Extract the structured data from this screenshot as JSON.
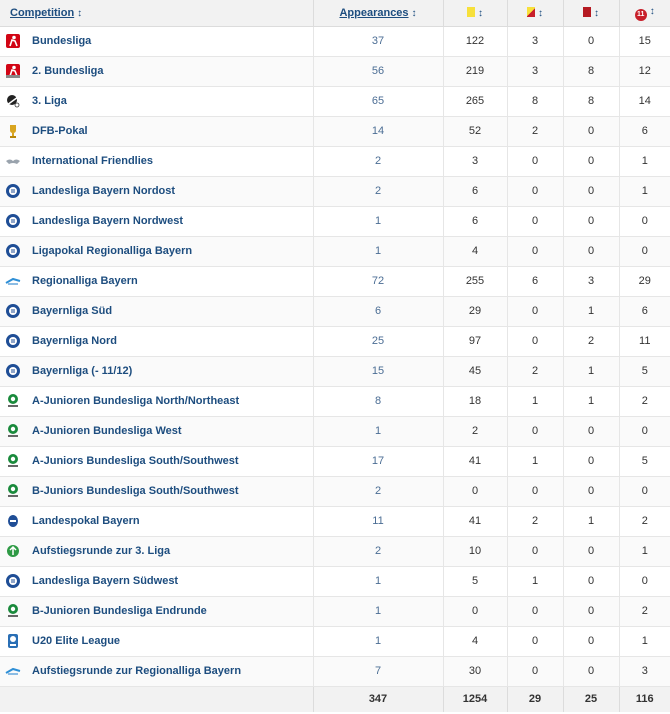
{
  "header": {
    "competition": "Competition",
    "appearances": "Appearances",
    "sort_glyph": "↕",
    "goals_glyph": "11"
  },
  "rows": [
    {
      "name": "Bundesliga",
      "logo": "bundesliga-logo",
      "apps": "37",
      "yellow": "122",
      "yr": "3",
      "red": "0",
      "goals": "15"
    },
    {
      "name": "2. Bundesliga",
      "logo": "2-bundesliga-logo",
      "apps": "56",
      "yellow": "219",
      "yr": "3",
      "red": "8",
      "goals": "12"
    },
    {
      "name": "3. Liga",
      "logo": "3-liga-logo",
      "apps": "65",
      "yellow": "265",
      "yr": "8",
      "red": "8",
      "goals": "14"
    },
    {
      "name": "DFB-Pokal",
      "logo": "dfb-pokal-logo",
      "apps": "14",
      "yellow": "52",
      "yr": "2",
      "red": "0",
      "goals": "6"
    },
    {
      "name": "International Friendlies",
      "logo": "handshake-logo",
      "apps": "2",
      "yellow": "3",
      "yr": "0",
      "red": "0",
      "goals": "1"
    },
    {
      "name": "Landesliga Bayern Nordost",
      "logo": "bfv-logo",
      "apps": "2",
      "yellow": "6",
      "yr": "0",
      "red": "0",
      "goals": "1"
    },
    {
      "name": "Landesliga Bayern Nordwest",
      "logo": "bfv-logo",
      "apps": "1",
      "yellow": "6",
      "yr": "0",
      "red": "0",
      "goals": "0"
    },
    {
      "name": "Ligapokal Regionalliga Bayern",
      "logo": "bfv-logo",
      "apps": "1",
      "yellow": "4",
      "yr": "0",
      "red": "0",
      "goals": "0"
    },
    {
      "name": "Regionalliga Bayern",
      "logo": "regionalliga-logo",
      "apps": "72",
      "yellow": "255",
      "yr": "6",
      "red": "3",
      "goals": "29"
    },
    {
      "name": "Bayernliga Süd",
      "logo": "bfv-logo",
      "apps": "6",
      "yellow": "29",
      "yr": "0",
      "red": "1",
      "goals": "6"
    },
    {
      "name": "Bayernliga Nord",
      "logo": "bfv-logo",
      "apps": "25",
      "yellow": "97",
      "yr": "0",
      "red": "2",
      "goals": "11"
    },
    {
      "name": "Bayernliga (- 11/12)",
      "logo": "bfv-logo",
      "apps": "15",
      "yellow": "45",
      "yr": "2",
      "red": "1",
      "goals": "5"
    },
    {
      "name": "A-Junioren Bundesliga North/Northeast",
      "logo": "dfb-junior-logo",
      "apps": "8",
      "yellow": "18",
      "yr": "1",
      "red": "1",
      "goals": "2"
    },
    {
      "name": "A-Junioren Bundesliga West",
      "logo": "dfb-junior-logo",
      "apps": "1",
      "yellow": "2",
      "yr": "0",
      "red": "0",
      "goals": "0"
    },
    {
      "name": "A-Juniors Bundesliga South/Southwest",
      "logo": "dfb-junior-logo",
      "apps": "17",
      "yellow": "41",
      "yr": "1",
      "red": "0",
      "goals": "5"
    },
    {
      "name": "B-Juniors Bundesliga South/Southwest",
      "logo": "dfb-junior-logo",
      "apps": "2",
      "yellow": "0",
      "yr": "0",
      "red": "0",
      "goals": "0"
    },
    {
      "name": "Landespokal Bayern",
      "logo": "landespokal-logo",
      "apps": "11",
      "yellow": "41",
      "yr": "2",
      "red": "1",
      "goals": "2"
    },
    {
      "name": "Aufstiegsrunde zur 3. Liga",
      "logo": "aufstiegsrunde-logo",
      "apps": "2",
      "yellow": "10",
      "yr": "0",
      "red": "0",
      "goals": "1"
    },
    {
      "name": "Landesliga Bayern Südwest",
      "logo": "bfv-logo",
      "apps": "1",
      "yellow": "5",
      "yr": "1",
      "red": "0",
      "goals": "0"
    },
    {
      "name": "B-Junioren Bundesliga Endrunde",
      "logo": "dfb-junior-logo",
      "apps": "1",
      "yellow": "0",
      "yr": "0",
      "red": "0",
      "goals": "2"
    },
    {
      "name": "U20 Elite League",
      "logo": "u20-elite-logo",
      "apps": "1",
      "yellow": "4",
      "yr": "0",
      "red": "0",
      "goals": "1"
    },
    {
      "name": "Aufstiegsrunde zur Regionalliga Bayern",
      "logo": "regionalliga-logo",
      "apps": "7",
      "yellow": "30",
      "yr": "0",
      "red": "0",
      "goals": "3"
    }
  ],
  "totals": {
    "apps": "347",
    "yellow": "1254",
    "yr": "29",
    "red": "25",
    "goals": "116"
  },
  "colors": {
    "link": "#1d4d7f",
    "yellow_card": "#f7e03b",
    "red_card": "#b51a22",
    "header_bg": "#f2f2f2"
  }
}
